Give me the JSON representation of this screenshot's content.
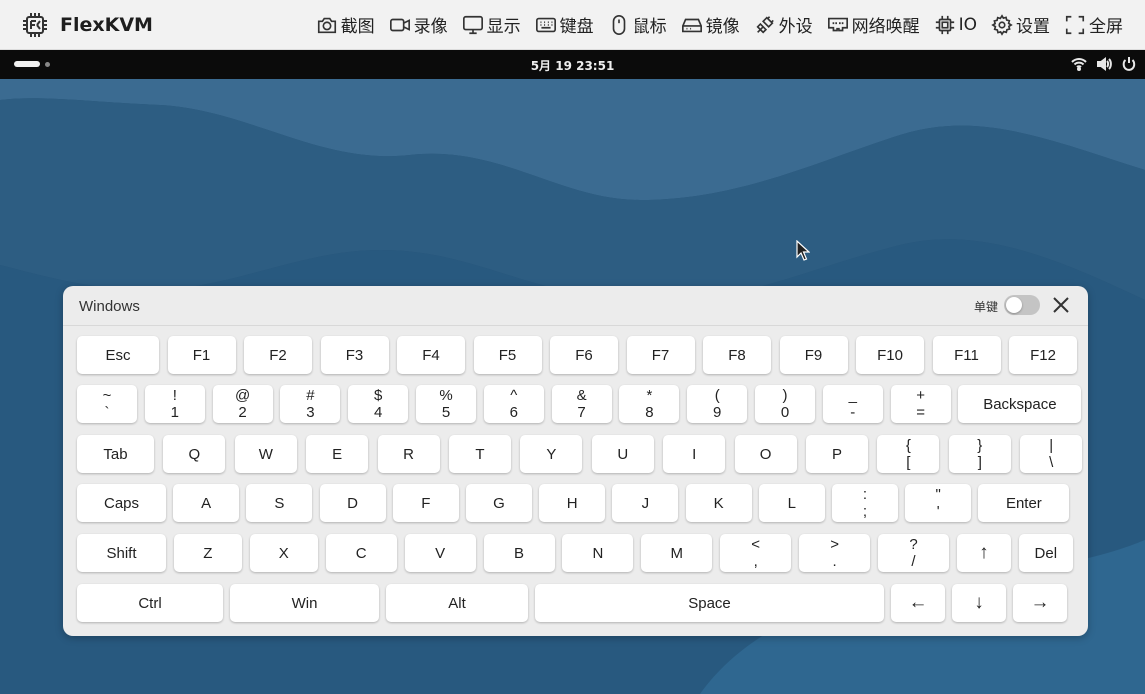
{
  "app": {
    "title": "FlexKVM",
    "menu": [
      {
        "icon": "camera-icon",
        "label": "截图"
      },
      {
        "icon": "video-camera-icon",
        "label": "录像"
      },
      {
        "icon": "monitor-icon",
        "label": "显示"
      },
      {
        "icon": "keyboard-icon",
        "label": "键盘"
      },
      {
        "icon": "mouse-icon",
        "label": "鼠标"
      },
      {
        "icon": "disk-drive-icon",
        "label": "镜像"
      },
      {
        "icon": "plug-icon",
        "label": "外设"
      },
      {
        "icon": "ethernet-port-icon",
        "label": "网络唤醒"
      },
      {
        "icon": "chip-icon",
        "label": "IO"
      },
      {
        "icon": "gear-icon",
        "label": "设置"
      },
      {
        "icon": "fullscreen-icon",
        "label": "全屏"
      }
    ]
  },
  "remote": {
    "clock": "5月 19  23:51",
    "tray_icons": [
      "wifi-icon",
      "volume-icon",
      "power-icon"
    ]
  },
  "keyboard": {
    "title": "Windows",
    "single_key_label": "单键",
    "single_key_enabled": false,
    "rows": [
      [
        {
          "label": "Esc"
        },
        {
          "label": "F1"
        },
        {
          "label": "F2"
        },
        {
          "label": "F3"
        },
        {
          "label": "F4"
        },
        {
          "label": "F5"
        },
        {
          "label": "F6"
        },
        {
          "label": "F7"
        },
        {
          "label": "F8"
        },
        {
          "label": "F9"
        },
        {
          "label": "F10"
        },
        {
          "label": "F11"
        },
        {
          "label": "F12"
        }
      ],
      [
        {
          "top": "~",
          "bottom": "`"
        },
        {
          "top": "!",
          "bottom": "1"
        },
        {
          "top": "@",
          "bottom": "2"
        },
        {
          "top": "#",
          "bottom": "3"
        },
        {
          "top": "$",
          "bottom": "4"
        },
        {
          "top": "%",
          "bottom": "5"
        },
        {
          "top": "^",
          "bottom": "6"
        },
        {
          "top": "&",
          "bottom": "7"
        },
        {
          "top": "*",
          "bottom": "8"
        },
        {
          "top": "(",
          "bottom": "9"
        },
        {
          "top": ")",
          "bottom": "0"
        },
        {
          "top": "_",
          "bottom": "-"
        },
        {
          "top": "+",
          "bottom": "="
        },
        {
          "label": "Backspace"
        }
      ],
      [
        {
          "label": "Tab"
        },
        {
          "label": "Q"
        },
        {
          "label": "W"
        },
        {
          "label": "E"
        },
        {
          "label": "R"
        },
        {
          "label": "T"
        },
        {
          "label": "Y"
        },
        {
          "label": "U"
        },
        {
          "label": "I"
        },
        {
          "label": "O"
        },
        {
          "label": "P"
        },
        {
          "top": "{",
          "bottom": "["
        },
        {
          "top": "}",
          "bottom": "]"
        },
        {
          "top": "|",
          "bottom": "\\"
        }
      ],
      [
        {
          "label": "Caps"
        },
        {
          "label": "A"
        },
        {
          "label": "S"
        },
        {
          "label": "D"
        },
        {
          "label": "F"
        },
        {
          "label": "G"
        },
        {
          "label": "H"
        },
        {
          "label": "J"
        },
        {
          "label": "K"
        },
        {
          "label": "L"
        },
        {
          "top": ":",
          "bottom": ";"
        },
        {
          "top": "\"",
          "bottom": "'"
        },
        {
          "label": "Enter"
        }
      ],
      [
        {
          "label": "Shift"
        },
        {
          "label": "Z"
        },
        {
          "label": "X"
        },
        {
          "label": "C"
        },
        {
          "label": "V"
        },
        {
          "label": "B"
        },
        {
          "label": "N"
        },
        {
          "label": "M"
        },
        {
          "top": "<",
          "bottom": ","
        },
        {
          "top": ">",
          "bottom": "."
        },
        {
          "top": "?",
          "bottom": "/"
        },
        {
          "label": "↑"
        },
        {
          "label": "Del"
        }
      ],
      [
        {
          "label": "Ctrl"
        },
        {
          "label": "Win"
        },
        {
          "label": "Alt"
        },
        {
          "label": "Space"
        },
        {
          "label": "←"
        },
        {
          "label": "↓"
        },
        {
          "label": "→"
        }
      ]
    ]
  }
}
